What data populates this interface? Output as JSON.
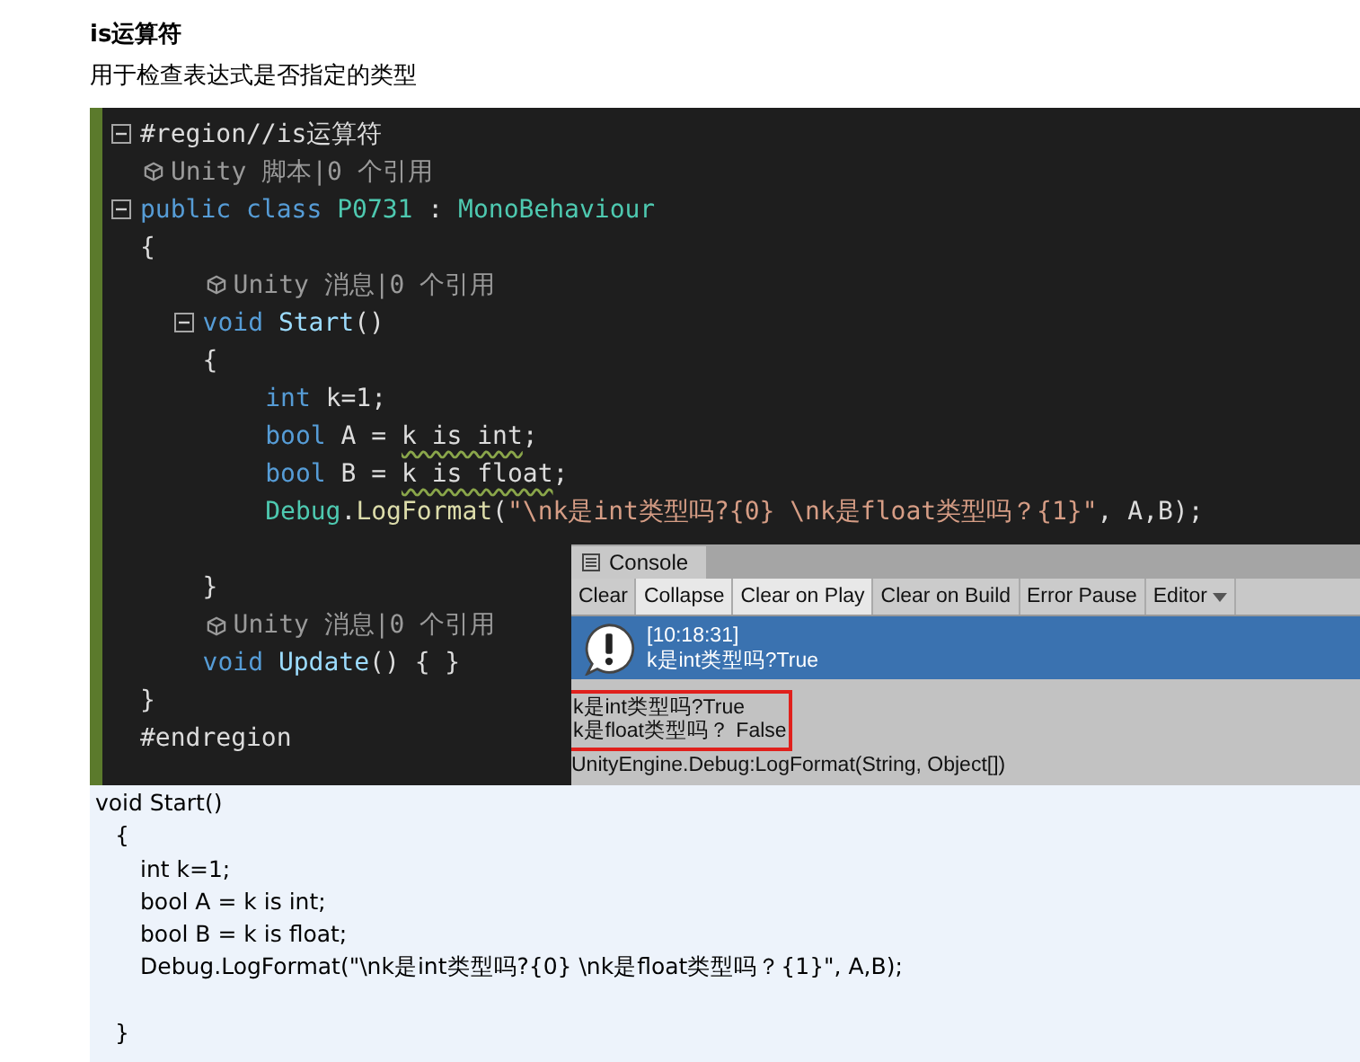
{
  "heading": "is运算符",
  "description": "用于检查表达式是否指定的类型",
  "editor": {
    "lines": [
      {
        "kind": "line",
        "fold": true,
        "tokens": [
          {
            "kind": "plain",
            "text": "#region//is运算符"
          }
        ]
      },
      {
        "kind": "hint",
        "text": "Unity 脚本|0 个引用"
      },
      {
        "kind": "line",
        "fold": true,
        "tokens": [
          {
            "kind": "keyword",
            "text": "public"
          },
          {
            "kind": "keyword",
            "text": " class"
          },
          {
            "kind": "type",
            "text": " P0731"
          },
          {
            "kind": "plain",
            "text": " : "
          },
          {
            "kind": "type",
            "text": "MonoBehaviour"
          }
        ]
      },
      {
        "kind": "line",
        "fold": false,
        "tokens": [
          {
            "kind": "plain",
            "text": "{"
          }
        ]
      },
      {
        "kind": "block",
        "children": [
          {
            "kind": "hint",
            "text": "Unity 消息|0 个引用"
          },
          {
            "kind": "line",
            "fold": true,
            "tokens": [
              {
                "kind": "keyword",
                "text": "void"
              },
              {
                "kind": "method",
                "text": " Start"
              },
              {
                "kind": "plain",
                "text": "()"
              }
            ]
          },
          {
            "kind": "line",
            "fold": false,
            "tokens": [
              {
                "kind": "plain",
                "text": "{"
              }
            ]
          },
          {
            "kind": "block",
            "children": [
              {
                "kind": "line",
                "fold": false,
                "tokens": [
                  {
                    "kind": "keyword",
                    "text": "int"
                  },
                  {
                    "kind": "plain",
                    "text": " k=1;"
                  }
                ]
              },
              {
                "kind": "line",
                "fold": false,
                "tokens": [
                  {
                    "kind": "keyword",
                    "text": "bool"
                  },
                  {
                    "kind": "plain",
                    "text": " A = "
                  },
                  {
                    "kind": "plain",
                    "text": "k is int",
                    "squiggle": true
                  },
                  {
                    "kind": "plain",
                    "text": ";"
                  }
                ]
              },
              {
                "kind": "line",
                "fold": false,
                "tokens": [
                  {
                    "kind": "keyword",
                    "text": "bool"
                  },
                  {
                    "kind": "plain",
                    "text": " B = "
                  },
                  {
                    "kind": "plain",
                    "text": "k is float",
                    "squiggle": true
                  },
                  {
                    "kind": "plain",
                    "text": ";"
                  }
                ]
              },
              {
                "kind": "line",
                "fold": false,
                "tokens": [
                  {
                    "kind": "type",
                    "text": "Debug"
                  },
                  {
                    "kind": "plain",
                    "text": "."
                  },
                  {
                    "kind": "call",
                    "text": "LogFormat"
                  },
                  {
                    "kind": "plain",
                    "text": "("
                  },
                  {
                    "kind": "string",
                    "text": "\"\\nk是int类型吗?{0} \\nk是float类型吗？{1}\""
                  },
                  {
                    "kind": "plain",
                    "text": ", A,B);"
                  }
                ]
              },
              {
                "kind": "blank"
              }
            ]
          },
          {
            "kind": "line",
            "fold": false,
            "tokens": [
              {
                "kind": "plain",
                "text": "}"
              }
            ]
          },
          {
            "kind": "hint",
            "text": "Unity 消息|0 个引用"
          },
          {
            "kind": "line",
            "fold": false,
            "tokens": [
              {
                "kind": "keyword",
                "text": "void"
              },
              {
                "kind": "method",
                "text": " Update"
              },
              {
                "kind": "plain",
                "text": "() { }"
              }
            ]
          }
        ]
      },
      {
        "kind": "line",
        "fold": false,
        "tokens": [
          {
            "kind": "plain",
            "text": "}"
          }
        ]
      },
      {
        "kind": "line",
        "fold": false,
        "tokens": [
          {
            "kind": "plain",
            "text": "#endregion"
          }
        ]
      }
    ]
  },
  "console": {
    "tab": "Console",
    "buttons": [
      {
        "label": "Clear",
        "on": false
      },
      {
        "label": "Collapse",
        "on": true
      },
      {
        "label": "Clear on Play",
        "on": true
      },
      {
        "label": "Clear on Build",
        "on": false
      },
      {
        "label": "Error Pause",
        "on": false
      },
      {
        "label": "Editor",
        "on": false,
        "dropdown": true
      }
    ],
    "entry": {
      "time": "[10:18:31]",
      "message": "k是int类型吗?True",
      "selected": true
    },
    "detail": [
      "k是int类型吗?True",
      "k是float类型吗？ False"
    ],
    "trace": "UnityEngine.Debug:LogFormat(String, Object[])"
  },
  "code_text": [
    {
      "kind": "line",
      "text": "void Start()"
    },
    {
      "kind": "block",
      "children": [
        {
          "kind": "line",
          "text": "{"
        },
        {
          "kind": "block",
          "children": [
            {
              "kind": "line",
              "text": "int k=1;"
            },
            {
              "kind": "line",
              "text": "bool A = k is int;"
            },
            {
              "kind": "line",
              "text": "bool B = k is float;"
            },
            {
              "kind": "line",
              "text": "Debug.LogFormat(\"\\nk是int类型吗?{0} \\nk是float类型吗？{1}\", A,B);"
            },
            {
              "kind": "blank"
            }
          ]
        },
        {
          "kind": "line",
          "text": "}"
        }
      ]
    }
  ]
}
